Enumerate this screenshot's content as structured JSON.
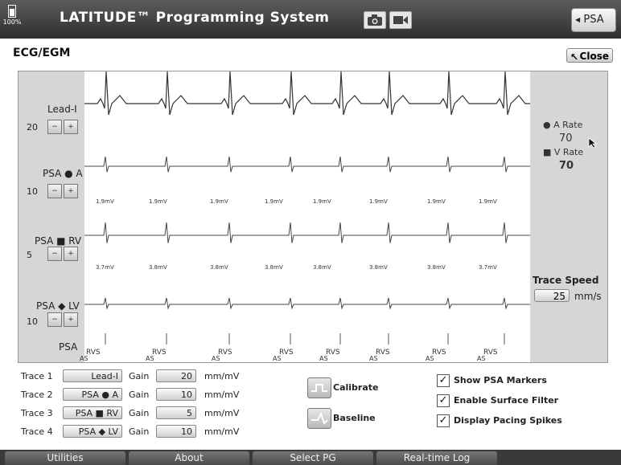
{
  "title_bar": {
    "battery_pct": "100%",
    "app_title": "LATITUDE™ Programming System",
    "psa_button": "PSA"
  },
  "panel": {
    "title": "ECG/EGM",
    "close_button": "Close"
  },
  "traces_left": [
    {
      "label": "Lead-I",
      "gain": "20"
    },
    {
      "label": "PSA ● A",
      "gain": "10"
    },
    {
      "label": "PSA ■ RV",
      "gain": "5"
    },
    {
      "label": "PSA ◆ LV",
      "gain": "10"
    },
    {
      "label": "PSA",
      "gain": ""
    }
  ],
  "amplitudes_row1": [
    "1.9mV",
    "1.9mV",
    "1.9mV",
    "1.9mV",
    "1.9mV",
    "1.9mV",
    "1.9mV",
    "1.9mV"
  ],
  "amplitudes_row2": [
    "3.7mV",
    "3.8mV",
    "3.8mV",
    "3.8mV",
    "3.8mV",
    "3.8mV",
    "3.8mV",
    "3.7mV"
  ],
  "markers": [
    "RVS",
    "RVS",
    "RVS",
    "RVS",
    "RVS",
    "RVS",
    "RVS",
    "RVS"
  ],
  "marker_sub": "AS",
  "rates": {
    "a_label": "● A Rate",
    "a_value": "70",
    "v_label": "■ V Rate",
    "v_value": "70"
  },
  "trace_speed": {
    "label": "Trace Speed",
    "value": "25",
    "unit": "mm/s"
  },
  "controls": [
    {
      "trace": "Trace 1",
      "source": "Lead-I",
      "gain_label": "Gain",
      "gain": "20",
      "unit": "mm/mV"
    },
    {
      "trace": "Trace 2",
      "source": "PSA ● A",
      "gain_label": "Gain",
      "gain": "10",
      "unit": "mm/mV"
    },
    {
      "trace": "Trace 3",
      "source": "PSA ■ RV",
      "gain_label": "Gain",
      "gain": "5",
      "unit": "mm/mV"
    },
    {
      "trace": "Trace 4",
      "source": "PSA ◆ LV",
      "gain_label": "Gain",
      "gain": "10",
      "unit": "mm/mV"
    }
  ],
  "buttons": {
    "calibrate": "Calibrate",
    "baseline": "Baseline"
  },
  "options": [
    {
      "label": "Show PSA Markers",
      "checked": true
    },
    {
      "label": "Enable Surface Filter",
      "checked": true
    },
    {
      "label": "Display Pacing Spikes",
      "checked": true
    }
  ],
  "tabs": [
    "Utilities",
    "About",
    "Select PG",
    "Real-time Log"
  ]
}
